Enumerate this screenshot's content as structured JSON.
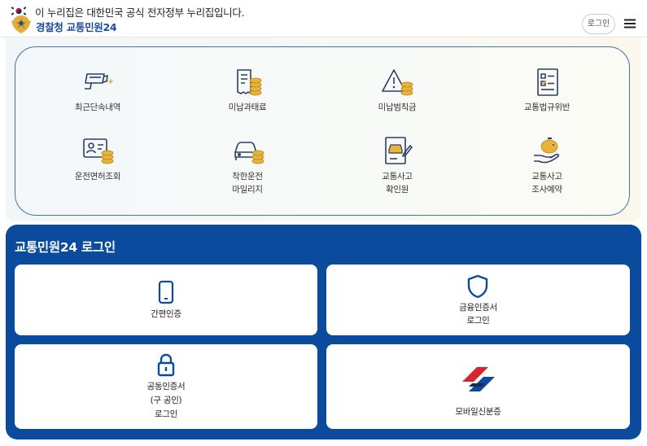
{
  "gov_banner": {
    "text": "이 누리집은 대한민국 공식 전자정부 누리집입니다."
  },
  "header": {
    "logo_org": "경찰청",
    "logo_service": "교통민원24",
    "login_button": "로그인",
    "menu_icon": "hamburger-menu-icon"
  },
  "services": [
    {
      "line1": "최근단속내역",
      "line2": "",
      "icon": "camera-sparkle-icon"
    },
    {
      "line1": "미납과태료",
      "line2": "",
      "icon": "receipt-coins-icon"
    },
    {
      "line1": "미납범칙금",
      "line2": "",
      "icon": "warning-coins-icon"
    },
    {
      "line1": "교통법규위반",
      "line2": "",
      "icon": "checklist-document-icon"
    },
    {
      "line1": "운전면허조회",
      "line2": "",
      "icon": "license-card-coins-icon"
    },
    {
      "line1": "착한운전",
      "line2": "마일리지",
      "icon": "car-coins-icon"
    },
    {
      "line1": "교통사고",
      "line2": "확인원",
      "icon": "accident-report-icon"
    },
    {
      "line1": "교통사고",
      "line2": "조사예약",
      "icon": "piggy-bank-hand-icon"
    }
  ],
  "login": {
    "title": "교통민원24 로그인",
    "options": [
      {
        "lines": [
          "간편인증"
        ],
        "icon": "smartphone-icon"
      },
      {
        "lines": [
          "금융인증서",
          "로그인"
        ],
        "icon": "shield-icon"
      },
      {
        "lines": [
          "공동인증서",
          "(구 공인)",
          "로그인"
        ],
        "icon": "padlock-icon"
      },
      {
        "lines": [
          "모바일신분증"
        ],
        "icon": "mobile-id-logo-icon"
      }
    ]
  },
  "colors": {
    "brand_blue": "#0a4b9e",
    "logo_blue": "#1b4d9b",
    "icon_navy": "#2c3e66",
    "coin_gold": "#e8b339",
    "card_border": "#3f73b5"
  }
}
